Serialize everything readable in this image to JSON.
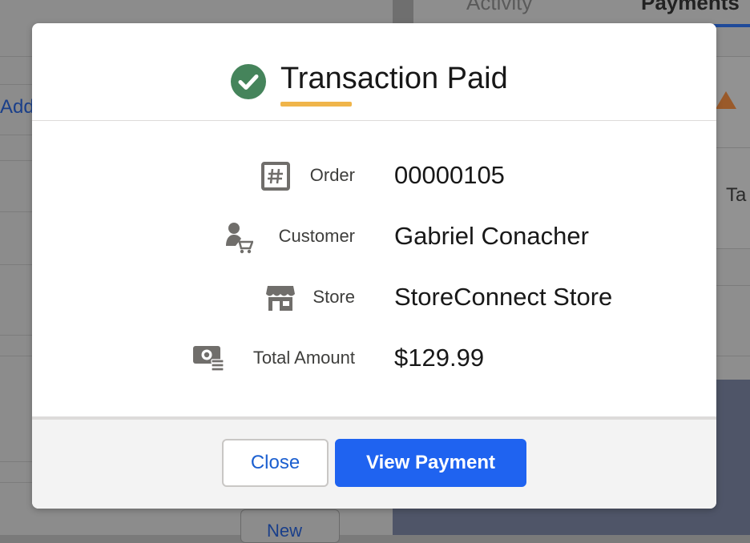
{
  "background": {
    "tab_activity": "Activity",
    "tab_payments": "Payments",
    "add_link": "Add",
    "ta_text": "Ta",
    "new_button": "New"
  },
  "modal": {
    "title": "Transaction Paid",
    "status_icon": "check-circle-icon",
    "status_color": "#45845b",
    "accent_color": "#f0b54a",
    "rows": [
      {
        "label": "Order",
        "value": "00000105",
        "icon": "hash-icon"
      },
      {
        "label": "Customer",
        "value": "Gabriel Conacher",
        "icon": "customer-cart-icon"
      },
      {
        "label": "Store",
        "value": "StoreConnect Store",
        "icon": "store-icon"
      },
      {
        "label": "Total Amount",
        "value": "$129.99",
        "icon": "money-icon"
      }
    ],
    "footer": {
      "close_label": "Close",
      "view_payment_label": "View Payment",
      "primary_color": "#1f63f0"
    }
  }
}
